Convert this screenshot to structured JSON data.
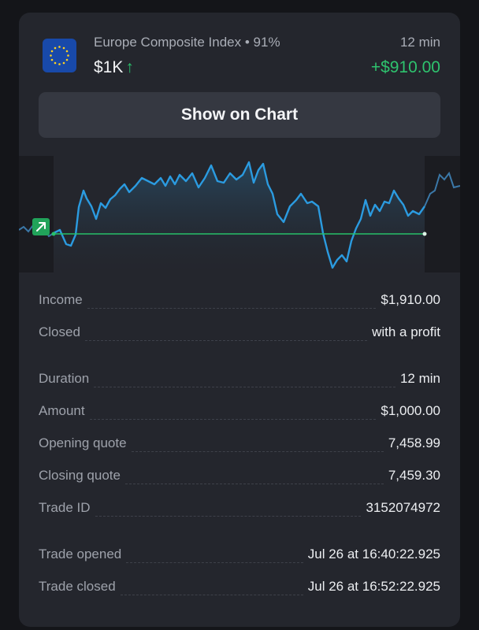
{
  "asset": {
    "name": "Europe Composite Index",
    "payout": "91%",
    "stake": "$1K",
    "duration": "12 min",
    "profit": "+$910.00",
    "icon": "eu-flag-icon"
  },
  "button": {
    "label": "Show on Chart"
  },
  "chart": {
    "marker_icon": "arrow-up-right-icon",
    "line_color": "#2b9be0",
    "baseline_color": "#27c06a"
  },
  "details": [
    {
      "key": "income",
      "label": "Income",
      "value": "$1,910.00"
    },
    {
      "key": "closed",
      "label": "Closed",
      "value": "with a profit"
    },
    {
      "key": "duration",
      "label": "Duration",
      "value": "12 min"
    },
    {
      "key": "amount",
      "label": "Amount",
      "value": "$1,000.00"
    },
    {
      "key": "open-quote",
      "label": "Opening quote",
      "value": "7,458.99"
    },
    {
      "key": "close-quote",
      "label": "Closing quote",
      "value": "7,459.30"
    },
    {
      "key": "trade-id",
      "label": "Trade ID",
      "value": "3152074972"
    },
    {
      "key": "opened",
      "label": "Trade opened",
      "value": "Jul 26 at 16:40:22.925"
    },
    {
      "key": "closed-at",
      "label": "Trade closed",
      "value": "Jul 26 at 16:52:22.925"
    }
  ]
}
